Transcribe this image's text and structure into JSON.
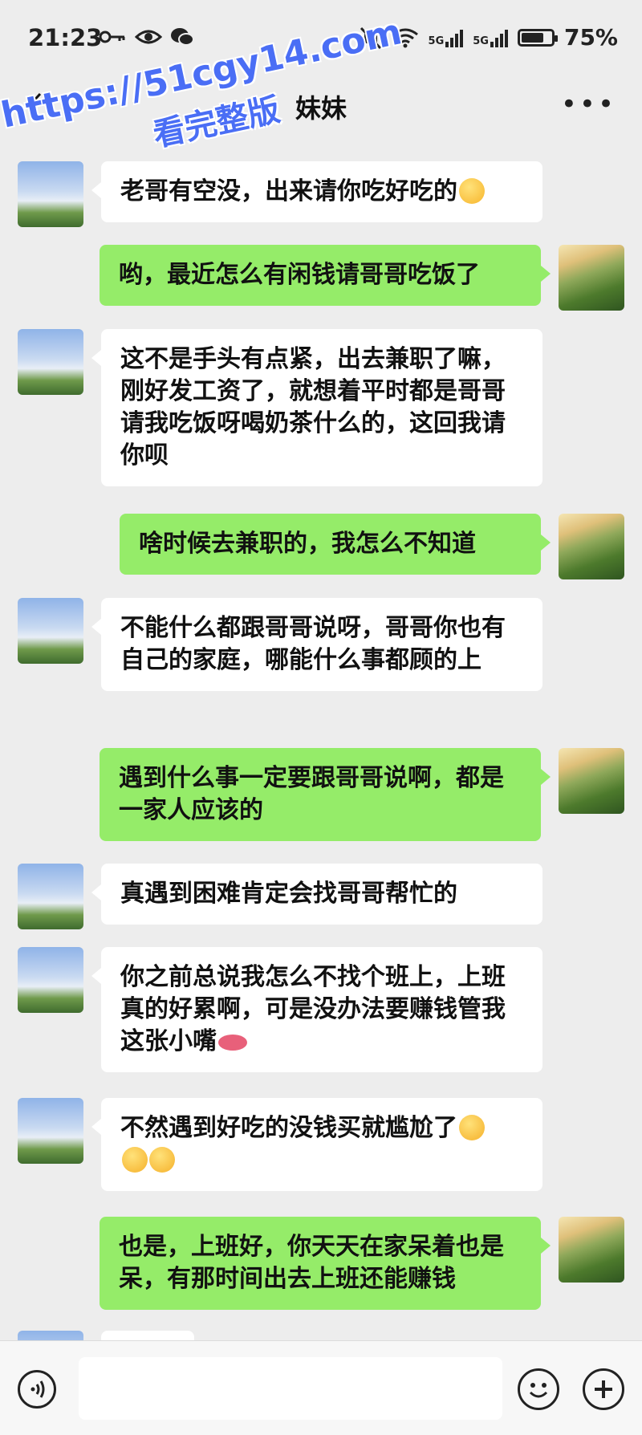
{
  "status_bar": {
    "time": "21:23",
    "network_1": "5G",
    "network_2": "5G",
    "battery_percent": "75%",
    "battery_level": 0.75
  },
  "watermark": {
    "url": "https://51cgy14.com",
    "caption": "看完整版"
  },
  "header": {
    "title": "妹妹"
  },
  "messages": [
    {
      "side": "in",
      "text": "老哥有空没，出来请你吃好吃的",
      "emoji": "yum"
    },
    {
      "side": "out",
      "text": "哟，最近怎么有闲钱请哥哥吃饭了"
    },
    {
      "side": "in",
      "text": "这不是手头有点紧，出去兼职了嘛，刚好发工资了，就想着平时都是哥哥请我吃饭呀喝奶茶什么的，这回我请你呗"
    },
    {
      "side": "out",
      "text": "啥时候去兼职的，我怎么不知道"
    },
    {
      "side": "in",
      "text": "不能什么都跟哥哥说呀，哥哥你也有自己的家庭，哪能什么事都顾的上"
    },
    {
      "side": "out",
      "text": "遇到什么事一定要跟哥哥说啊，都是一家人应该的"
    },
    {
      "side": "in",
      "text": "真遇到困难肯定会找哥哥帮忙的"
    },
    {
      "side": "in",
      "text": "你之前总说我怎么不找个班上，上班真的好累啊，可是没办法要赚钱管我这张小嘴",
      "emoji": "lips"
    },
    {
      "side": "in",
      "text": "不然遇到好吃的没钱买就尴尬了",
      "emoji": "rofl-x3"
    },
    {
      "side": "out",
      "text": "也是，上班好，你天天在家呆着也是呆，有那时间出去上班还能赚钱"
    }
  ],
  "input_bar": {
    "voice_icon": "voice-icon",
    "emoji_icon": "smile-icon",
    "plus_icon": "plus-icon"
  }
}
